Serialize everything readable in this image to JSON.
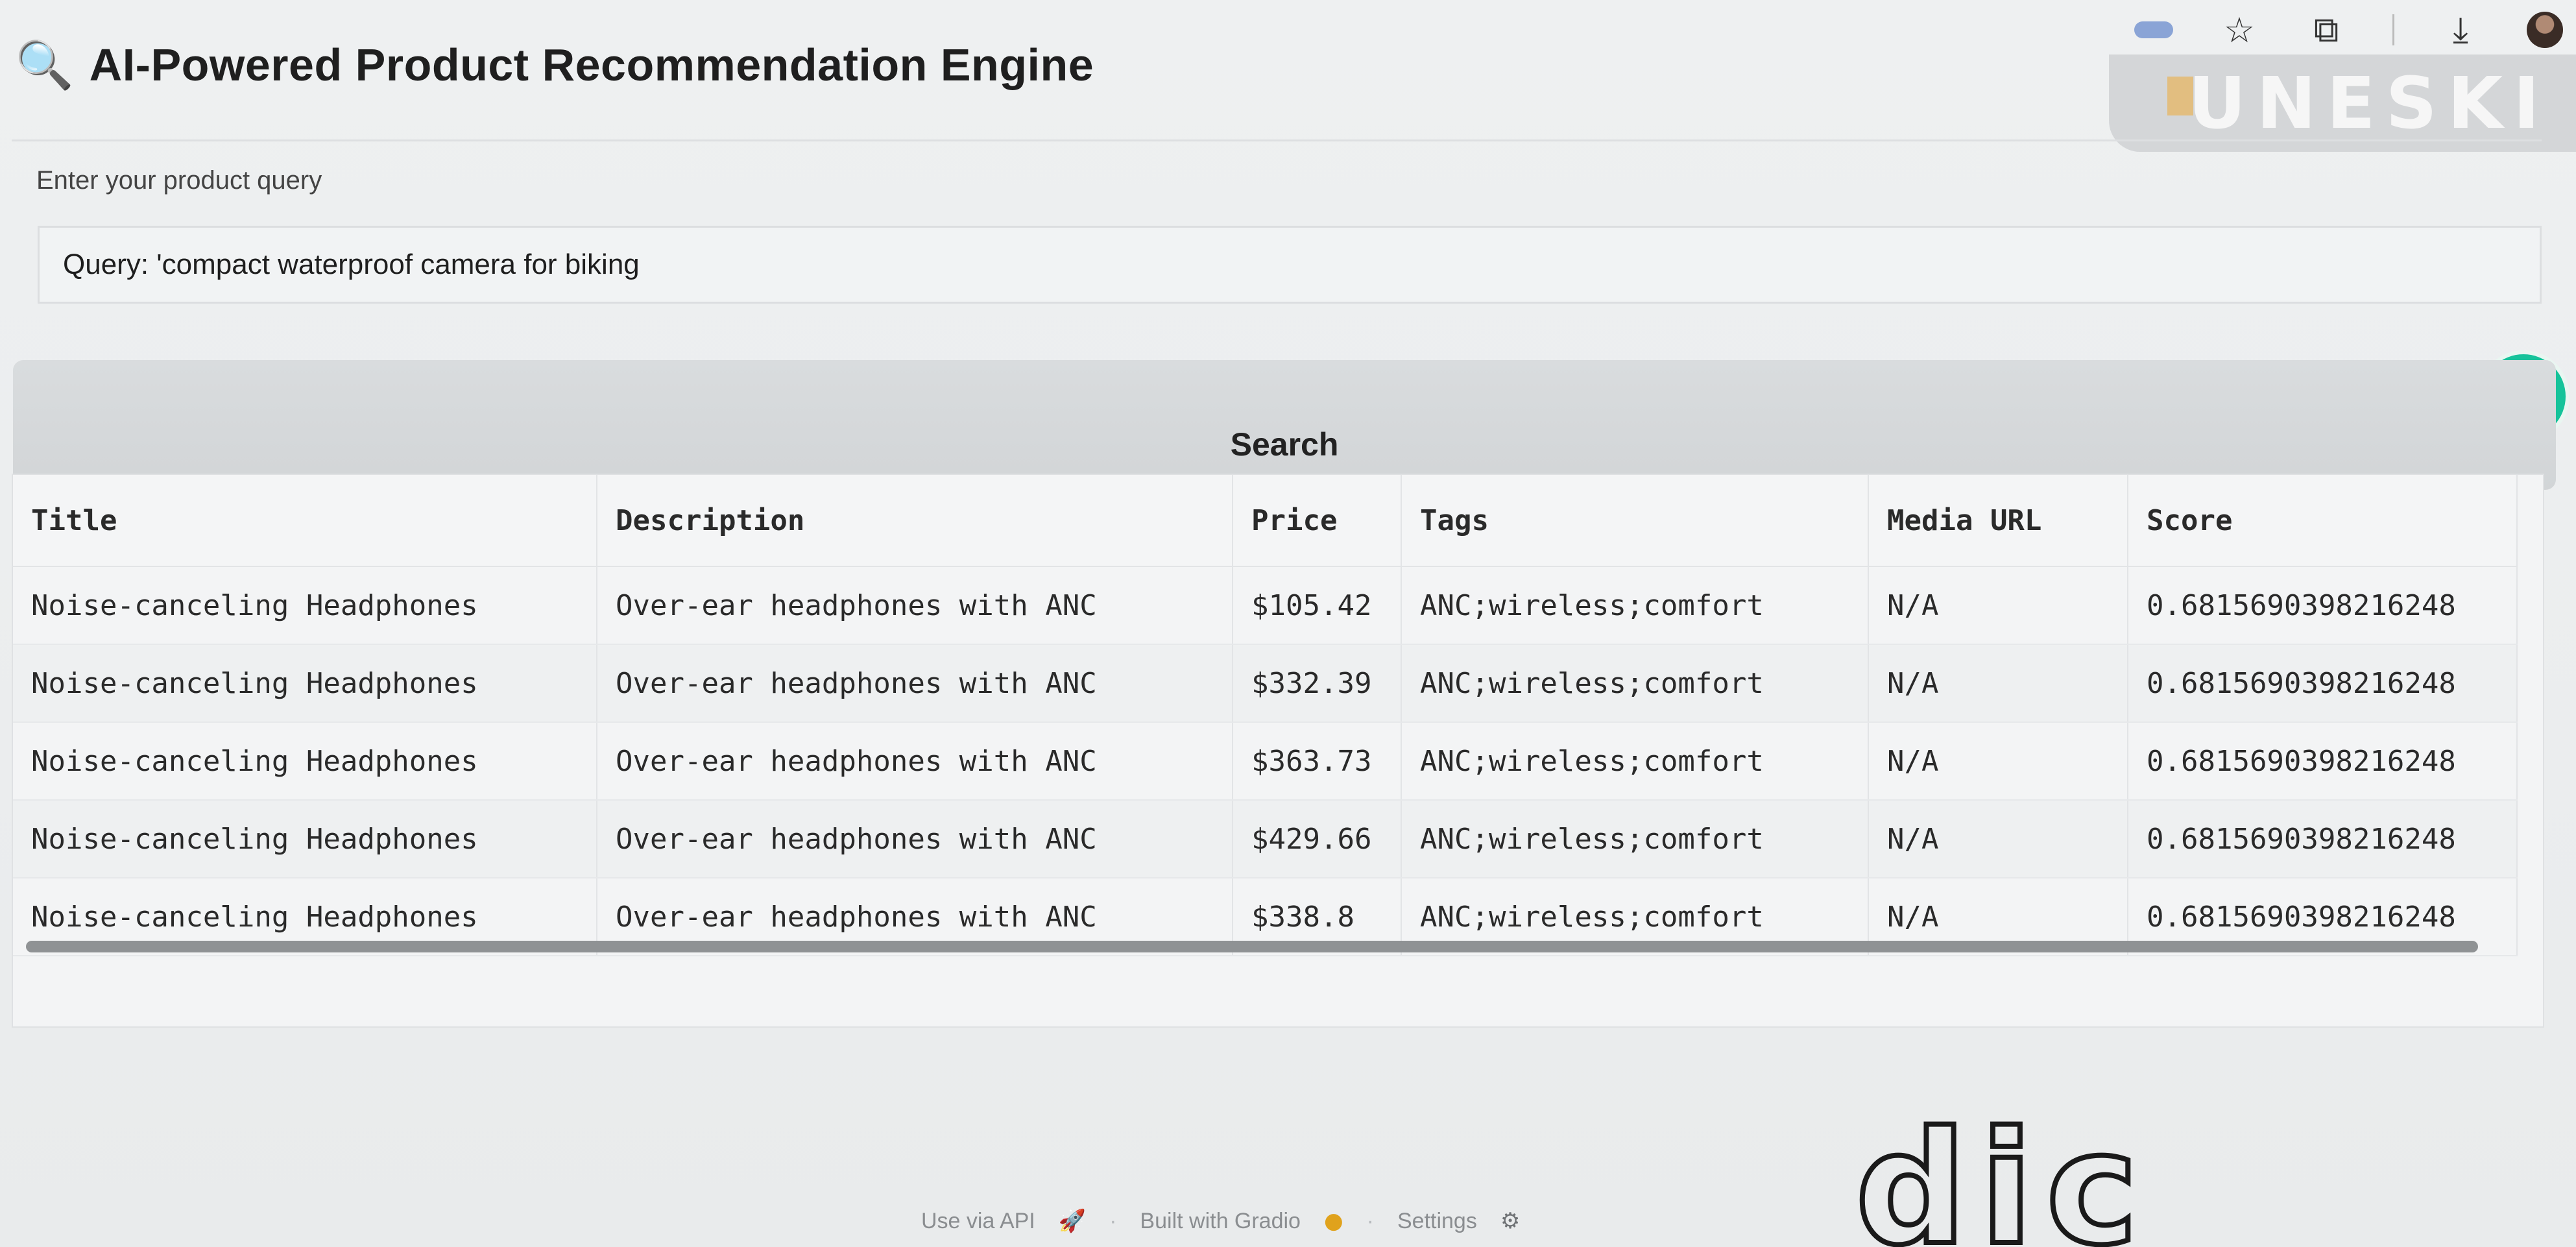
{
  "header": {
    "icon": "magnifier-icon",
    "title": "AI-Powered Product Recommendation Engine"
  },
  "query": {
    "label": "Enter your product query",
    "value": "Query: 'compact waterproof camera for biking"
  },
  "search": {
    "button_label": "Search"
  },
  "results": {
    "columns": [
      "Title",
      "Description",
      "Price",
      "Tags",
      "Media URL",
      "Score"
    ],
    "rows": [
      [
        "Noise-canceling Headphones",
        "Over-ear headphones with ANC",
        "$105.42",
        "ANC;wireless;comfort",
        "N/A",
        "0.6815690398216248"
      ],
      [
        "Noise-canceling Headphones",
        "Over-ear headphones with ANC",
        "$332.39",
        "ANC;wireless;comfort",
        "N/A",
        "0.6815690398216248"
      ],
      [
        "Noise-canceling Headphones",
        "Over-ear headphones with ANC",
        "$363.73",
        "ANC;wireless;comfort",
        "N/A",
        "0.6815690398216248"
      ],
      [
        "Noise-canceling Headphones",
        "Over-ear headphones with ANC",
        "$429.66",
        "ANC;wireless;comfort",
        "N/A",
        "0.6815690398216248"
      ],
      [
        "Noise-canceling Headphones",
        "Over-ear headphones with ANC",
        "$338.8",
        "ANC;wireless;comfort",
        "N/A",
        "0.6815690398216248"
      ]
    ]
  },
  "footer": {
    "api_label": "Use via API",
    "built_label": "Built with Gradio",
    "settings_label": "Settings",
    "separator": "·"
  },
  "watermark": {
    "text": "UNESKI"
  },
  "colors": {
    "page_bg": "#eceeef",
    "button_bg": "#d6d9db",
    "grammarly": "#15c39a"
  }
}
